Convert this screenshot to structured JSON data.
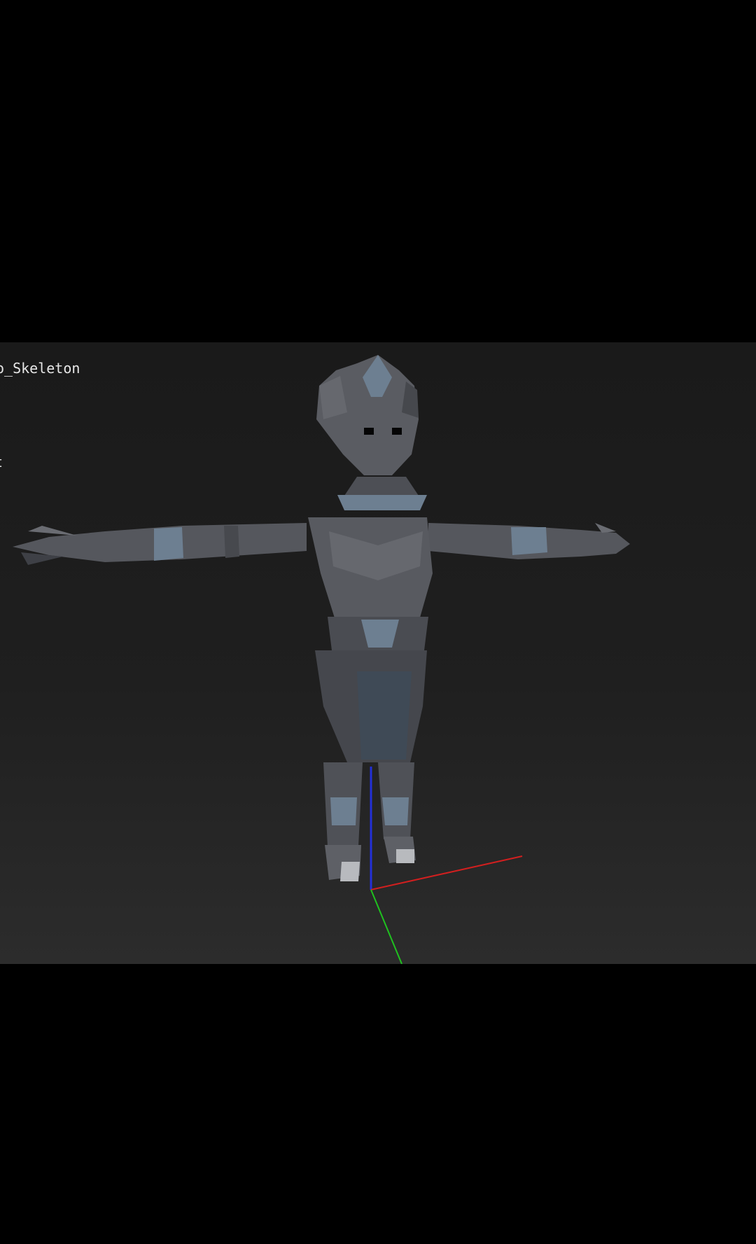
{
  "viewport": {
    "skeleton_label": "o_Skeleton",
    "partial_label": "t",
    "background": "#1f1f1f",
    "model_color": "#55575d",
    "trim_color": "#6d7f91",
    "axis_colors": {
      "x": "#d21f1f",
      "y": "#1fc21f",
      "z": "#2330d8"
    },
    "icons": {
      "model": "character-model-icon",
      "gizmo": "axis-gizmo-icon"
    }
  }
}
